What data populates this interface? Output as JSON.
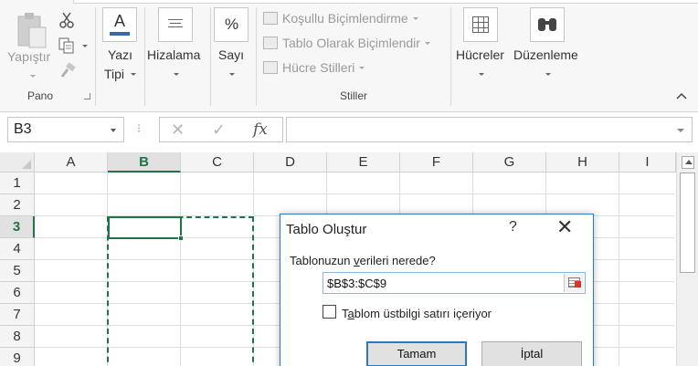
{
  "ribbon": {
    "clipboard": {
      "paste_label": "Yapıştır",
      "group_label": "Pano"
    },
    "font": {
      "label_line1": "Yazı",
      "label_line2": "Tipi"
    },
    "alignment": {
      "label": "Hizalama"
    },
    "number": {
      "label": "Sayı",
      "icon_text": "%"
    },
    "styles": {
      "conditional": "Koşullu Biçimlendirme",
      "as_table": "Tablo Olarak Biçimlendir",
      "cell_styles": "Hücre Stilleri",
      "group_label": "Stiller"
    },
    "cells": {
      "label": "Hücreler"
    },
    "editing": {
      "label": "Düzenleme"
    }
  },
  "formula_bar": {
    "name_box": "B3",
    "separator": "⁝",
    "cancel": "✕",
    "enter": "✓",
    "fx": "fx",
    "value": ""
  },
  "grid": {
    "columns": [
      "A",
      "B",
      "C",
      "D",
      "E",
      "F",
      "G",
      "H",
      "I"
    ],
    "rows": [
      "1",
      "2",
      "3",
      "4",
      "5",
      "6",
      "7",
      "8",
      "9"
    ],
    "active_column": "B",
    "active_row": "3"
  },
  "dialog": {
    "title": "Tablo Oluştur",
    "help": "?",
    "close": "✕",
    "question_pre": "Tablonuzun ",
    "question_underlined": "v",
    "question_post": "erileri nerede?",
    "range_value": "$B$3:$C$9",
    "checkbox_pre": "T",
    "checkbox_underlined": "a",
    "checkbox_post": "blom üstbilgi satırı içeriyor",
    "checkbox_checked": false,
    "ok_label": "Tamam",
    "cancel_label": "İptal"
  },
  "colors": {
    "excel_green": "#217346",
    "dialog_border": "#2b7ac0"
  }
}
